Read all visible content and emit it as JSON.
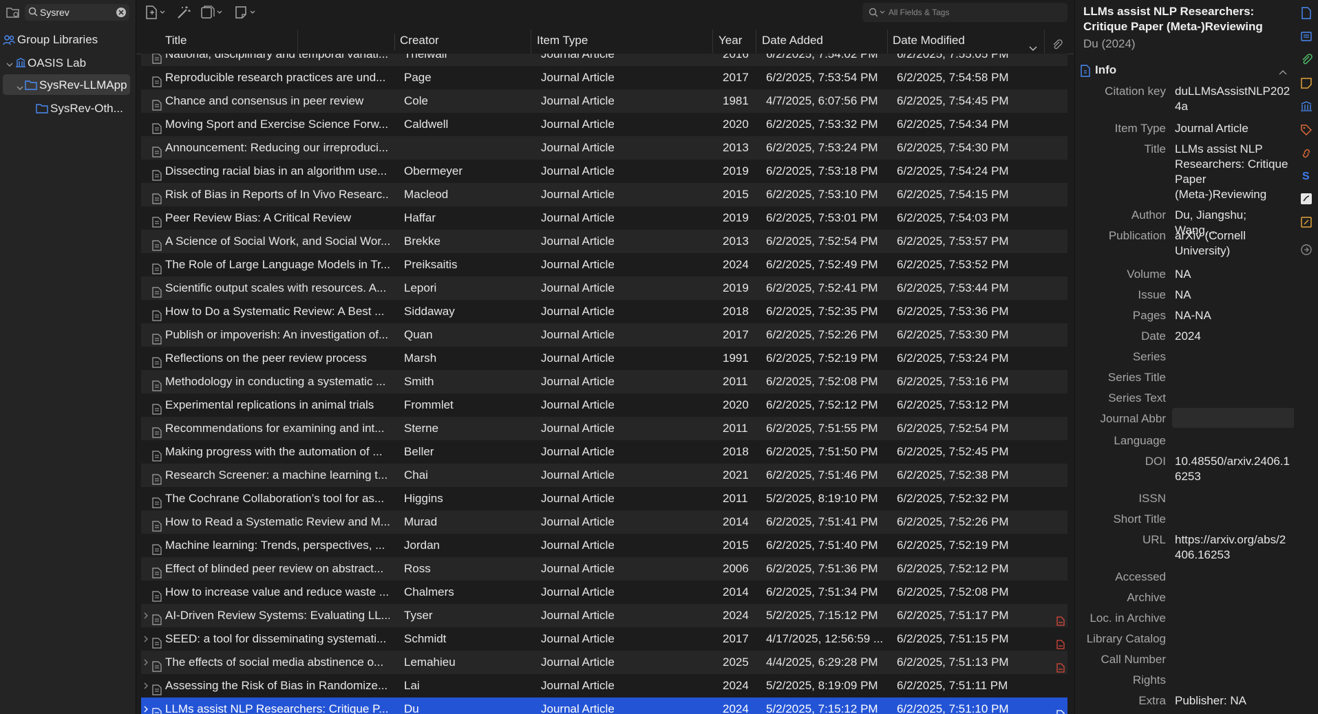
{
  "left_pane": {
    "filter_value": "Sysrev",
    "tree": {
      "group_libraries": "Group Libraries",
      "oasis_lab": "OASIS Lab",
      "sysrev_llmapp": "SysRev-LLMApp",
      "sysrev_other": "SysRev-Oth..."
    }
  },
  "items": {
    "search_placeholder": "All Fields & Tags",
    "columns": {
      "title": "Title",
      "creator": "Creator",
      "item_type": "Item Type",
      "year": "Year",
      "date_added": "Date Added",
      "date_modified": "Date Modified"
    },
    "rows": [
      {
        "title": "National, disciplinary and temporal variati...",
        "creator": "Thelwall",
        "type": "Journal Article",
        "year": "2016",
        "added": "6/2/2025, 7:54:02 PM",
        "modified": "6/2/2025, 7:55:05 PM",
        "twisty": false,
        "pdf": false
      },
      {
        "title": "Reproducible research practices are und...",
        "creator": "Page",
        "type": "Journal Article",
        "year": "2017",
        "added": "6/2/2025, 7:53:54 PM",
        "modified": "6/2/2025, 7:54:58 PM",
        "twisty": false,
        "pdf": false
      },
      {
        "title": "Chance and consensus in peer review",
        "creator": "Cole",
        "type": "Journal Article",
        "year": "1981",
        "added": "4/7/2025, 6:07:56 PM",
        "modified": "6/2/2025, 7:54:45 PM",
        "twisty": false,
        "pdf": false
      },
      {
        "title": "Moving Sport and Exercise Science Forw...",
        "creator": "Caldwell",
        "type": "Journal Article",
        "year": "2020",
        "added": "6/2/2025, 7:53:32 PM",
        "modified": "6/2/2025, 7:54:34 PM",
        "twisty": false,
        "pdf": false
      },
      {
        "title": "Announcement: Reducing our irreproduci...",
        "creator": "",
        "type": "Journal Article",
        "year": "2013",
        "added": "6/2/2025, 7:53:24 PM",
        "modified": "6/2/2025, 7:54:30 PM",
        "twisty": false,
        "pdf": false
      },
      {
        "title": "Dissecting racial bias in an algorithm use...",
        "creator": "Obermeyer",
        "type": "Journal Article",
        "year": "2019",
        "added": "6/2/2025, 7:53:18 PM",
        "modified": "6/2/2025, 7:54:24 PM",
        "twisty": false,
        "pdf": false
      },
      {
        "title": "Risk of Bias in Reports of In Vivo Researc...",
        "creator": "Macleod",
        "type": "Journal Article",
        "year": "2015",
        "added": "6/2/2025, 7:53:10 PM",
        "modified": "6/2/2025, 7:54:15 PM",
        "twisty": false,
        "pdf": false
      },
      {
        "title": "Peer Review Bias: A Critical Review",
        "creator": "Haffar",
        "type": "Journal Article",
        "year": "2019",
        "added": "6/2/2025, 7:53:01 PM",
        "modified": "6/2/2025, 7:54:03 PM",
        "twisty": false,
        "pdf": false
      },
      {
        "title": "A Science of Social Work, and Social Wor...",
        "creator": "Brekke",
        "type": "Journal Article",
        "year": "2013",
        "added": "6/2/2025, 7:52:54 PM",
        "modified": "6/2/2025, 7:53:57 PM",
        "twisty": false,
        "pdf": false
      },
      {
        "title": "The Role of Large Language Models in Tr...",
        "creator": "Preiksaitis",
        "type": "Journal Article",
        "year": "2024",
        "added": "6/2/2025, 7:52:49 PM",
        "modified": "6/2/2025, 7:53:52 PM",
        "twisty": false,
        "pdf": false
      },
      {
        "title": "Scientific output scales with resources. A...",
        "creator": "Lepori",
        "type": "Journal Article",
        "year": "2019",
        "added": "6/2/2025, 7:52:41 PM",
        "modified": "6/2/2025, 7:53:44 PM",
        "twisty": false,
        "pdf": false
      },
      {
        "title": "How to Do a Systematic Review: A Best ...",
        "creator": "Siddaway",
        "type": "Journal Article",
        "year": "2018",
        "added": "6/2/2025, 7:52:35 PM",
        "modified": "6/2/2025, 7:53:36 PM",
        "twisty": false,
        "pdf": false
      },
      {
        "title": "Publish or impoverish: An investigation of...",
        "creator": "Quan",
        "type": "Journal Article",
        "year": "2017",
        "added": "6/2/2025, 7:52:26 PM",
        "modified": "6/2/2025, 7:53:30 PM",
        "twisty": false,
        "pdf": false
      },
      {
        "title": "Reflections on the peer review process",
        "creator": "Marsh",
        "type": "Journal Article",
        "year": "1991",
        "added": "6/2/2025, 7:52:19 PM",
        "modified": "6/2/2025, 7:53:24 PM",
        "twisty": false,
        "pdf": false
      },
      {
        "title": "Methodology in conducting a systematic ...",
        "creator": "Smith",
        "type": "Journal Article",
        "year": "2011",
        "added": "6/2/2025, 7:52:08 PM",
        "modified": "6/2/2025, 7:53:16 PM",
        "twisty": false,
        "pdf": false
      },
      {
        "title": "Experimental replications in animal trials",
        "creator": "Frommlet",
        "type": "Journal Article",
        "year": "2020",
        "added": "6/2/2025, 7:52:12 PM",
        "modified": "6/2/2025, 7:53:12 PM",
        "twisty": false,
        "pdf": false
      },
      {
        "title": "Recommendations for examining and int...",
        "creator": "Sterne",
        "type": "Journal Article",
        "year": "2011",
        "added": "6/2/2025, 7:51:55 PM",
        "modified": "6/2/2025, 7:52:54 PM",
        "twisty": false,
        "pdf": false
      },
      {
        "title": "Making progress with the automation of ...",
        "creator": "Beller",
        "type": "Journal Article",
        "year": "2018",
        "added": "6/2/2025, 7:51:50 PM",
        "modified": "6/2/2025, 7:52:45 PM",
        "twisty": false,
        "pdf": false
      },
      {
        "title": "Research Screener: a machine learning t...",
        "creator": "Chai",
        "type": "Journal Article",
        "year": "2021",
        "added": "6/2/2025, 7:51:46 PM",
        "modified": "6/2/2025, 7:52:38 PM",
        "twisty": false,
        "pdf": false
      },
      {
        "title": "The Cochrane Collaboration’s tool for as...",
        "creator": "Higgins",
        "type": "Journal Article",
        "year": "2011",
        "added": "5/2/2025, 8:19:10 PM",
        "modified": "6/2/2025, 7:52:32 PM",
        "twisty": false,
        "pdf": false
      },
      {
        "title": "How to Read a Systematic Review and M...",
        "creator": "Murad",
        "type": "Journal Article",
        "year": "2014",
        "added": "6/2/2025, 7:51:41 PM",
        "modified": "6/2/2025, 7:52:26 PM",
        "twisty": false,
        "pdf": false
      },
      {
        "title": "Machine learning: Trends, perspectives, ...",
        "creator": "Jordan",
        "type": "Journal Article",
        "year": "2015",
        "added": "6/2/2025, 7:51:40 PM",
        "modified": "6/2/2025, 7:52:19 PM",
        "twisty": false,
        "pdf": false
      },
      {
        "title": "Effect of blinded peer review on abstract...",
        "creator": "Ross",
        "type": "Journal Article",
        "year": "2006",
        "added": "6/2/2025, 7:51:36 PM",
        "modified": "6/2/2025, 7:52:12 PM",
        "twisty": false,
        "pdf": false
      },
      {
        "title": "How to increase value and reduce waste ...",
        "creator": "Chalmers",
        "type": "Journal Article",
        "year": "2014",
        "added": "6/2/2025, 7:51:34 PM",
        "modified": "6/2/2025, 7:52:08 PM",
        "twisty": false,
        "pdf": false
      },
      {
        "title": "AI-Driven Review Systems: Evaluating LL...",
        "creator": "Tyser",
        "type": "Journal Article",
        "year": "2024",
        "added": "5/2/2025, 7:15:12 PM",
        "modified": "6/2/2025, 7:51:17 PM",
        "twisty": true,
        "pdf": true
      },
      {
        "title": "SEED: a tool for disseminating systemati...",
        "creator": "Schmidt",
        "type": "Journal Article",
        "year": "2017",
        "added": "4/17/2025, 12:56:59 ...",
        "modified": "6/2/2025, 7:51:15 PM",
        "twisty": true,
        "pdf": true
      },
      {
        "title": "The effects of social media abstinence o...",
        "creator": "Lemahieu",
        "type": "Journal Article",
        "year": "2025",
        "added": "4/4/2025, 6:29:28 PM",
        "modified": "6/2/2025, 7:51:13 PM",
        "twisty": true,
        "pdf": true
      },
      {
        "title": "Assessing the Risk of Bias in Randomize...",
        "creator": "Lai",
        "type": "Journal Article",
        "year": "2024",
        "added": "5/2/2025, 8:19:09 PM",
        "modified": "6/2/2025, 7:51:11 PM",
        "twisty": true,
        "pdf": false
      },
      {
        "title": "LLMs assist NLP Researchers: Critique P...",
        "creator": "Du",
        "type": "Journal Article",
        "year": "2024",
        "added": "5/2/2025, 7:15:12 PM",
        "modified": "6/2/2025, 7:51:10 PM",
        "twisty": true,
        "pdf": true,
        "selected": true
      }
    ]
  },
  "item_pane": {
    "title": "LLMs assist NLP Researchers: Critique Paper (Meta-)Reviewing",
    "subtitle": "Du (2024)",
    "section_label": "Info",
    "fields": [
      {
        "label": "Citation key",
        "value": "duLLMsAssistNLP2024a"
      },
      {
        "label": "Item Type",
        "value": "Journal Article"
      },
      {
        "label": "Title",
        "value": "LLMs assist NLP Researchers: Critique Paper (Meta-)Reviewing"
      },
      {
        "label": "Author",
        "value": "Du, Jiangshu; Wang,..."
      },
      {
        "label": "Publication",
        "value": "arXiv (Cornell University)"
      },
      {
        "label": "Volume",
        "value": "NA"
      },
      {
        "label": "Issue",
        "value": "NA"
      },
      {
        "label": "Pages",
        "value": "NA-NA"
      },
      {
        "label": "Date",
        "value": "2024"
      },
      {
        "label": "Series",
        "value": ""
      },
      {
        "label": "Series Title",
        "value": ""
      },
      {
        "label": "Series Text",
        "value": ""
      },
      {
        "label": "Journal Abbr",
        "value": ""
      },
      {
        "label": "Language",
        "value": ""
      },
      {
        "label": "DOI",
        "value": "10.48550/arxiv.2406.16253"
      },
      {
        "label": "ISSN",
        "value": ""
      },
      {
        "label": "Short Title",
        "value": ""
      },
      {
        "label": "URL",
        "value": "https://arxiv.org/abs/2406.16253"
      },
      {
        "label": "Accessed",
        "value": ""
      },
      {
        "label": "Archive",
        "value": ""
      },
      {
        "label": "Loc. in Archive",
        "value": ""
      },
      {
        "label": "Library Catalog",
        "value": ""
      },
      {
        "label": "Call Number",
        "value": ""
      },
      {
        "label": "Rights",
        "value": ""
      },
      {
        "label": "Extra",
        "value": "Publisher: NA"
      }
    ]
  },
  "colors": {
    "selection": "#2454d6",
    "accent_blue": "#4a8cf7",
    "pdf_red": "#d9483b"
  }
}
